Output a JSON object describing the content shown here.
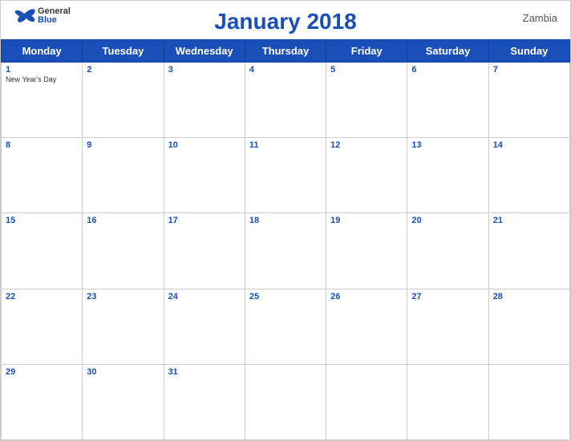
{
  "header": {
    "title": "January 2018",
    "country": "Zambia",
    "logo": {
      "general": "General",
      "blue": "Blue"
    }
  },
  "weekdays": [
    "Monday",
    "Tuesday",
    "Wednesday",
    "Thursday",
    "Friday",
    "Saturday",
    "Sunday"
  ],
  "weeks": [
    [
      {
        "day": 1,
        "holiday": "New Year's Day"
      },
      {
        "day": 2
      },
      {
        "day": 3
      },
      {
        "day": 4
      },
      {
        "day": 5
      },
      {
        "day": 6
      },
      {
        "day": 7
      }
    ],
    [
      {
        "day": 8
      },
      {
        "day": 9
      },
      {
        "day": 10
      },
      {
        "day": 11
      },
      {
        "day": 12
      },
      {
        "day": 13
      },
      {
        "day": 14
      }
    ],
    [
      {
        "day": 15
      },
      {
        "day": 16
      },
      {
        "day": 17
      },
      {
        "day": 18
      },
      {
        "day": 19
      },
      {
        "day": 20
      },
      {
        "day": 21
      }
    ],
    [
      {
        "day": 22
      },
      {
        "day": 23
      },
      {
        "day": 24
      },
      {
        "day": 25
      },
      {
        "day": 26
      },
      {
        "day": 27
      },
      {
        "day": 28
      }
    ],
    [
      {
        "day": 29
      },
      {
        "day": 30
      },
      {
        "day": 31
      },
      {
        "day": null
      },
      {
        "day": null
      },
      {
        "day": null
      },
      {
        "day": null
      }
    ]
  ],
  "accent_color": "#1a4fba"
}
